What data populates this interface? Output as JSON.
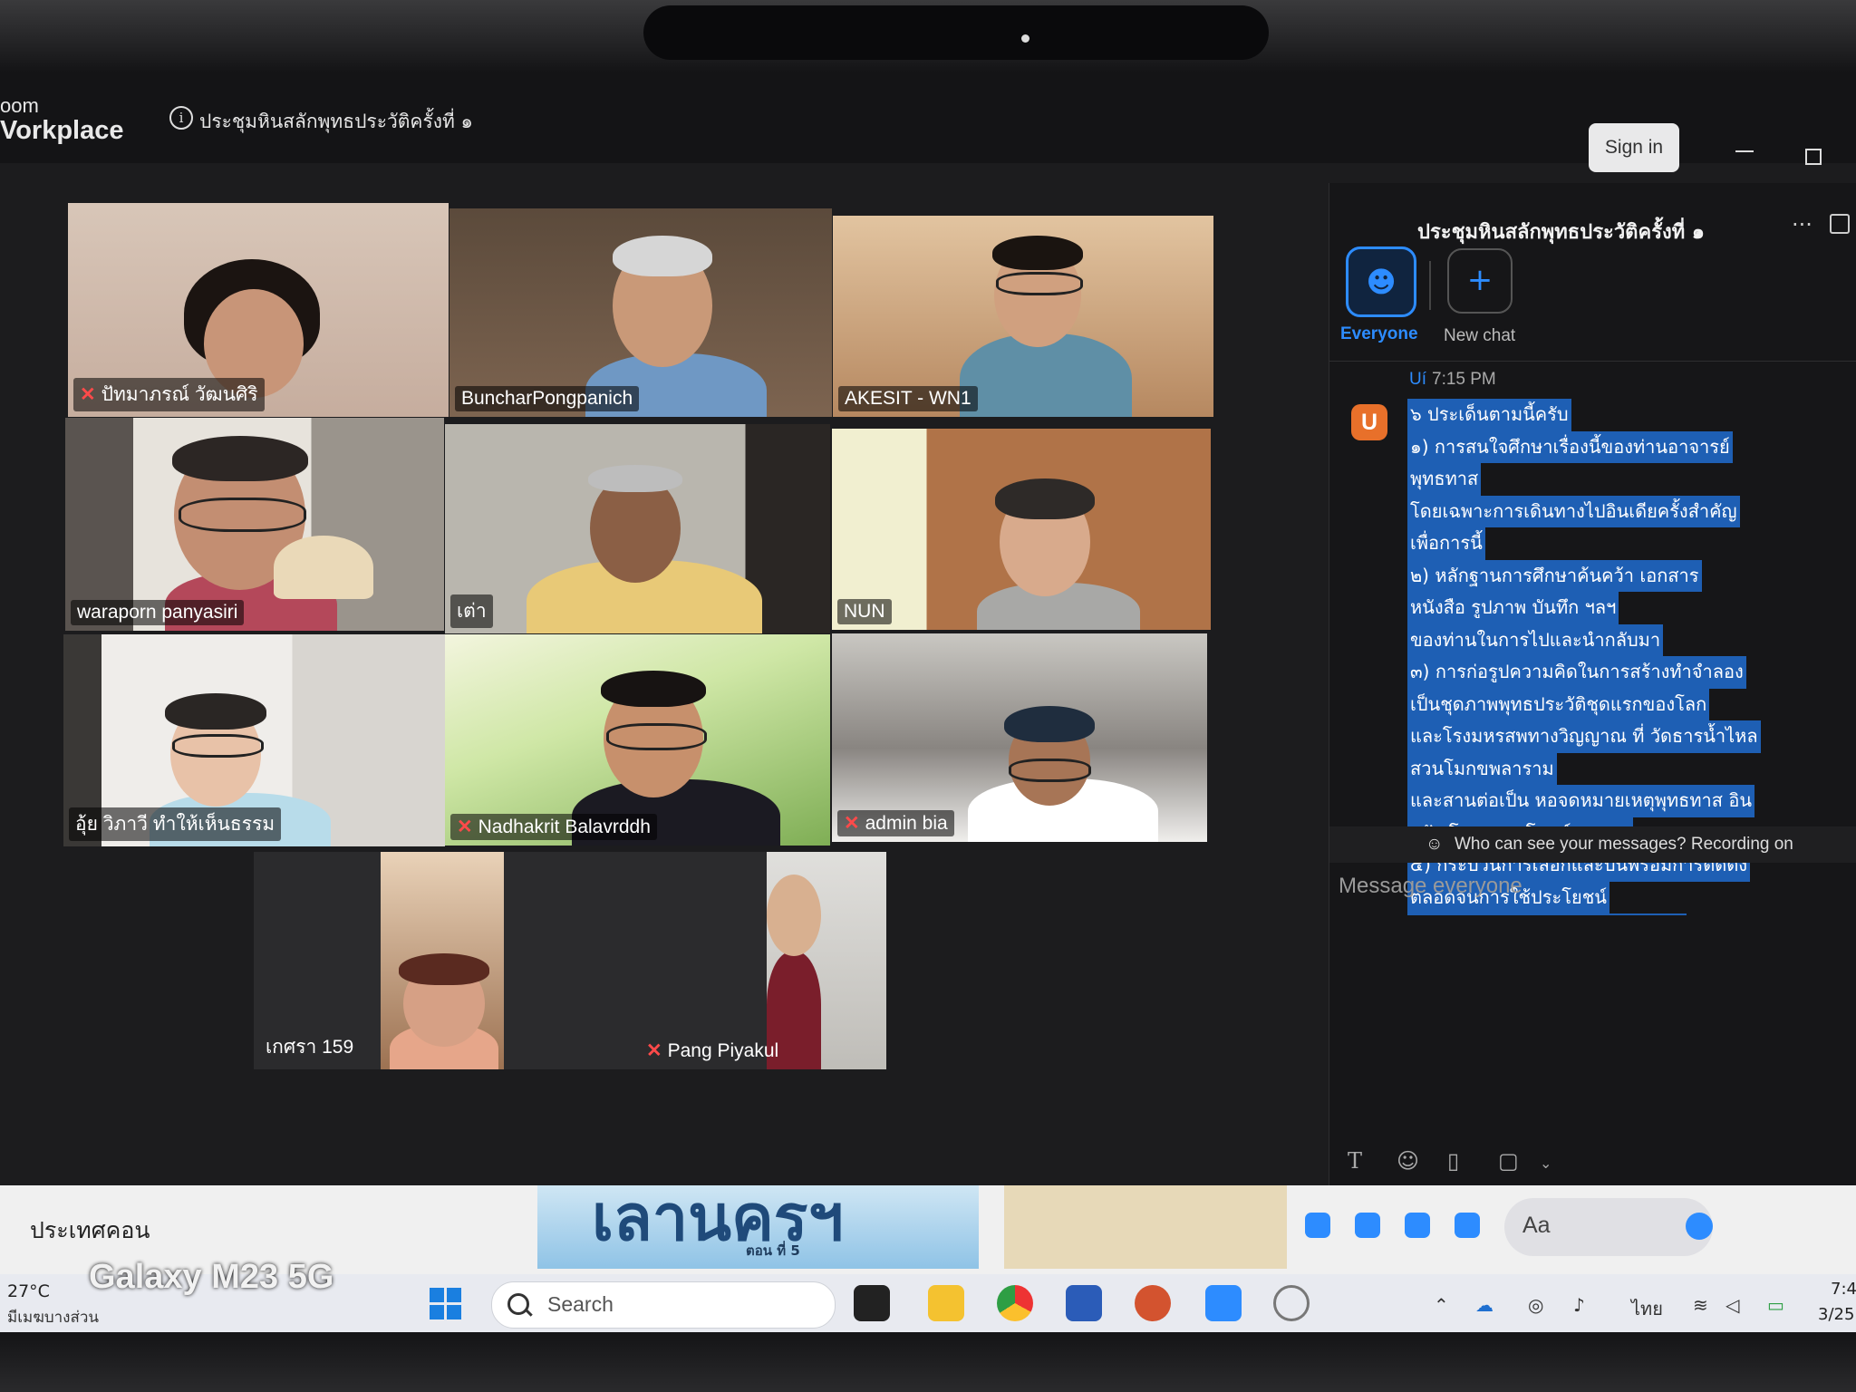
{
  "app": {
    "brand_line1": "oom",
    "brand_line2": "Vorkplace",
    "meeting_title": "ประชุมหินสลักพุทธประวัติครั้งที่ ๑",
    "sign_in_label": "Sign in"
  },
  "participants": [
    {
      "name": "ปัทมาภรณ์ วัฒนศิริ",
      "muted": true
    },
    {
      "name": "BuncharPongpanich",
      "muted": false
    },
    {
      "name": "AKESIT - WN1",
      "muted": false
    },
    {
      "name": "waraporn panyasiri",
      "muted": false
    },
    {
      "name": "เต่า",
      "muted": false
    },
    {
      "name": "NUN",
      "muted": false
    },
    {
      "name": "อุ้ย วิภาวี ทำให้เห็นธรรม",
      "muted": false
    },
    {
      "name": "Nadhakrit Balavrddh",
      "muted": true
    },
    {
      "name": "admin bia",
      "muted": true
    },
    {
      "name": "เกศรา 159",
      "muted": false
    },
    {
      "name": "Pang Piyakul",
      "muted": true
    }
  ],
  "chat": {
    "title": "ประชุมหินสลักพุทธประวัติครั้งที่ ๑",
    "more_label": "···",
    "everyone_label": "Everyone",
    "new_chat_label": "New chat",
    "message": {
      "sender": "Uí",
      "time": "7:15 PM",
      "avatar_letter": "U",
      "lines": [
        "๖ ประเด็นตามนี้ครับ",
        "๑) การสนใจศึกษาเรื่องนี้ของท่านอาจารย์",
        "พุทธทาส",
        "โดยเฉพาะการเดินทางไปอินเดียครั้งสำคัญ",
        "เพื่อการนี้",
        "๒) หลักฐานการศึกษาค้นคว้า เอกสาร",
        "หนังสือ รูปภาพ บันทึก ฯลฯ",
        "ของท่านในการไปและนำกลับมา",
        "๓) การก่อรูปความคิดในการสร้างทำจำลอง",
        "เป็นชุดภาพพุทธประวัติชุดแรกของโลก",
        "และโรงมหรสพทางวิญญาณ ที่ วัดธารน้ำไหล",
        "สวนโมกขพลาราม",
        "และสานต่อเป็น หอจดหมายเหตุพุทธทาส อิน",
        "ทปัญโญ - สวนโมกข์กรุงเทพ",
        "๔) กระบวนการเลือกและปั้นพร้อมการติดตั้ง",
        "ตลอดจนการใช้ประโยชน์",
        "๕) ตัวอย่าง ตัวอย่าง เสนอแนะ ผลง"
      ]
    },
    "privacy_note": "Who can see your messages? Recording on",
    "input_placeholder": "Message everyone"
  },
  "strip": {
    "page_title": "ประเทศคอน",
    "banner_big": "เลานครฯ",
    "banner_small": "ตอน ที่ 5",
    "composer_placeholder": "Aa"
  },
  "taskbar": {
    "temperature": "27°C",
    "weather": "มีเมฆบางส่วน",
    "search_label": "Search",
    "language": "ไทย",
    "time": "7:4",
    "date": "3/25"
  },
  "watermark": "Galaxy M23 5G",
  "colors": {
    "accent": "#2d8cff",
    "active_speaker": "#37d67a",
    "highlight": "#1e5fb4",
    "muted": "#ff4a4a"
  }
}
